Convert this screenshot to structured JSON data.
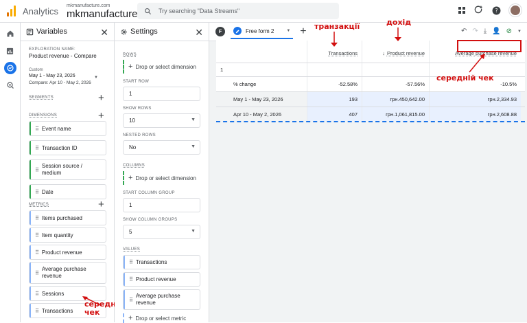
{
  "topbar": {
    "app_name": "Analytics",
    "property_small": "mkmanufacture.com",
    "property_big": "mkmanufacture.com",
    "search_placeholder": "Try searching \"Data Streams\""
  },
  "variables": {
    "title": "Variables",
    "exploration_label": "EXPLORATION NAME:",
    "exploration_name": "Product revenue - Compare",
    "date_custom": "Custom",
    "date_range": "May 1 - May 23, 2026",
    "date_compare": "Compare: Apr 10 - May 2, 2026",
    "segments_label": "SEGMENTS",
    "dimensions_label": "DIMENSIONS",
    "dimensions": [
      "Event name",
      "Transaction ID",
      "Session source / medium",
      "Date"
    ],
    "metrics_label": "METRICS",
    "metrics": [
      "Items purchased",
      "Item quantity",
      "Product revenue",
      "Average purchase revenue",
      "Sessions",
      "Transactions"
    ]
  },
  "settings": {
    "title": "Settings",
    "rows_label": "ROWS",
    "drop_dimension": "Drop or select dimension",
    "start_row_label": "START ROW",
    "start_row": "1",
    "show_rows_label": "SHOW ROWS",
    "show_rows": "10",
    "nested_rows_label": "NESTED ROWS",
    "nested_rows": "No",
    "columns_label": "COLUMNS",
    "drop_dimension_col": "Drop or select dimension",
    "start_col_group_label": "START COLUMN GROUP",
    "start_col_group": "1",
    "show_col_groups_label": "SHOW COLUMN GROUPS",
    "show_col_groups": "5",
    "values_label": "VALUES",
    "values": [
      "Transactions",
      "Product revenue",
      "Average purchase revenue"
    ],
    "drop_metric": "Drop or select metric"
  },
  "workarea": {
    "tab_letter": "F",
    "tab_name": "Free form 2",
    "headers": [
      "",
      "Transactions",
      "Product revenue",
      "Average purchase revenue"
    ],
    "row_index": "1",
    "rows": [
      {
        "label": "% change",
        "v1": "-52.58%",
        "v2": "-57.56%",
        "v3": "-10.5%"
      },
      {
        "label": "May 1 - May 23, 2026",
        "v1": "193",
        "v2": "грн.450,642.00",
        "v3": "грн.2,334.93"
      },
      {
        "label": "Apr 10 - May 2, 2026",
        "v1": "407",
        "v2": "грн.1,061,815.00",
        "v3": "грн.2,608.88"
      }
    ]
  },
  "annotations": {
    "transactions": "транзакції",
    "revenue": "дохід",
    "avg_check_table": "середній чек",
    "avg_check_list_1": "середній",
    "avg_check_list_2": "чек"
  },
  "colors": {
    "accent": "#1a73e8",
    "annotation_red": "#d20f0f",
    "dimension_green": "#34a853",
    "metric_blue": "#8ab4f8"
  }
}
